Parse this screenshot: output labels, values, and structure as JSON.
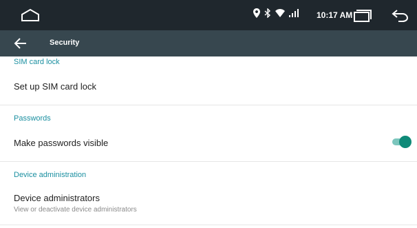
{
  "status_bar": {
    "time": "10:17 AM",
    "icons": [
      "home-outline-icon",
      "location-icon",
      "bluetooth-icon",
      "wifi-icon",
      "signal-icon",
      "recents-icon",
      "back-nav-icon"
    ]
  },
  "app_bar": {
    "title": "Security",
    "back_icon": "arrow-back-icon"
  },
  "sections": [
    {
      "header": "SIM card lock",
      "items": [
        {
          "title": "Set up SIM card lock"
        }
      ]
    },
    {
      "header": "Passwords",
      "items": [
        {
          "title": "Make passwords visible",
          "toggle": true
        }
      ]
    },
    {
      "header": "Device administration",
      "items": [
        {
          "title": "Device administrators",
          "subtitle": "View or deactivate device administrators"
        }
      ]
    }
  ],
  "colors": {
    "status_bar": "#1f272d",
    "app_bar": "#37474f",
    "section_header": "#1a8fa0",
    "toggle_on": "#0f8a78"
  }
}
